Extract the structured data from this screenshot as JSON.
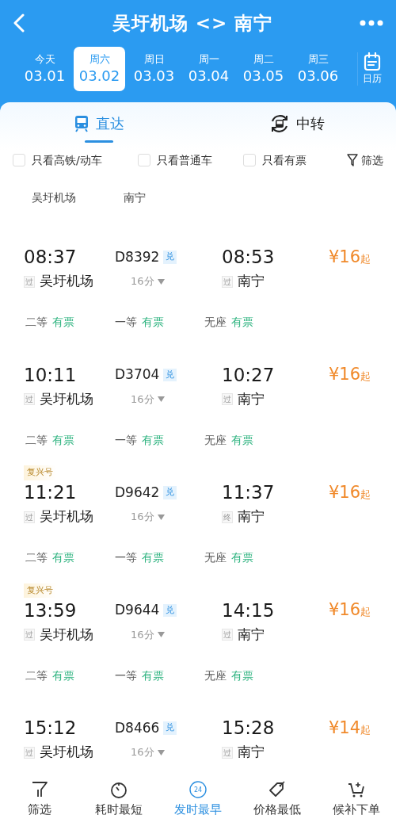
{
  "header": {
    "title": "吴圩机场 <> 南宁"
  },
  "dates": [
    {
      "weekday": "今天",
      "date": "03.01",
      "selected": false
    },
    {
      "weekday": "周六",
      "date": "03.02",
      "selected": true
    },
    {
      "weekday": "周日",
      "date": "03.03",
      "selected": false
    },
    {
      "weekday": "周一",
      "date": "03.04",
      "selected": false
    },
    {
      "weekday": "周二",
      "date": "03.05",
      "selected": false
    },
    {
      "weekday": "周三",
      "date": "03.06",
      "selected": false
    }
  ],
  "calendar": {
    "label": "日历"
  },
  "tabs": [
    {
      "label": "直达",
      "kind": "direct",
      "selected": true
    },
    {
      "label": "中转",
      "kind": "transfer",
      "selected": false
    }
  ],
  "filters": [
    {
      "label": "只看高铁/动车",
      "checked": false
    },
    {
      "label": "只看普通车",
      "checked": false
    },
    {
      "label": "只看有票",
      "checked": false
    }
  ],
  "filter_button": {
    "label": "筛选"
  },
  "station_headers": [
    "吴圩机场",
    "南宁"
  ],
  "trains": [
    {
      "depart_time": "08:37",
      "train_no": "D8392",
      "exchange": "兑",
      "duration": "16分",
      "arrive_time": "08:53",
      "price": "¥16",
      "price_suffix": "起",
      "from_tag": "过",
      "from": "吴圩机场",
      "to_tag": "过",
      "to": "南宁",
      "seats": [
        {
          "class": "二等",
          "status": "有票"
        },
        {
          "class": "一等",
          "status": "有票"
        },
        {
          "class": "无座",
          "status": "有票"
        }
      ]
    },
    {
      "depart_time": "10:11",
      "train_no": "D3704",
      "exchange": "兑",
      "duration": "16分",
      "arrive_time": "10:27",
      "price": "¥16",
      "price_suffix": "起",
      "from_tag": "过",
      "from": "吴圩机场",
      "to_tag": "过",
      "to": "南宁",
      "seats": [
        {
          "class": "二等",
          "status": "有票"
        },
        {
          "class": "一等",
          "status": "有票"
        },
        {
          "class": "无座",
          "status": "有票"
        }
      ]
    },
    {
      "badge": "复兴号",
      "depart_time": "11:21",
      "train_no": "D9642",
      "exchange": "兑",
      "duration": "16分",
      "arrive_time": "11:37",
      "price": "¥16",
      "price_suffix": "起",
      "from_tag": "过",
      "from": "吴圩机场",
      "to_tag": "终",
      "to": "南宁",
      "seats": [
        {
          "class": "二等",
          "status": "有票"
        },
        {
          "class": "一等",
          "status": "有票"
        },
        {
          "class": "无座",
          "status": "有票"
        }
      ]
    },
    {
      "badge": "复兴号",
      "depart_time": "13:59",
      "train_no": "D9644",
      "exchange": "兑",
      "duration": "16分",
      "arrive_time": "14:15",
      "price": "¥16",
      "price_suffix": "起",
      "from_tag": "过",
      "from": "吴圩机场",
      "to_tag": "过",
      "to": "南宁",
      "seats": [
        {
          "class": "二等",
          "status": "有票"
        },
        {
          "class": "一等",
          "status": "有票"
        },
        {
          "class": "无座",
          "status": "有票"
        }
      ]
    },
    {
      "depart_time": "15:12",
      "train_no": "D8466",
      "exchange": "兑",
      "duration": "16分",
      "arrive_time": "15:28",
      "price": "¥14",
      "price_suffix": "起",
      "from_tag": "过",
      "from": "吴圩机场",
      "to_tag": "过",
      "to": "南宁"
    }
  ],
  "bottom_nav": [
    {
      "label": "筛选",
      "kind": "filter",
      "selected": false
    },
    {
      "label": "耗时最短",
      "kind": "duration",
      "selected": false
    },
    {
      "label": "发时最早",
      "kind": "earliest",
      "icon_text": "24",
      "selected": true
    },
    {
      "label": "价格最低",
      "kind": "price",
      "selected": false
    },
    {
      "label": "候补下单",
      "kind": "waitlist",
      "selected": false
    }
  ]
}
